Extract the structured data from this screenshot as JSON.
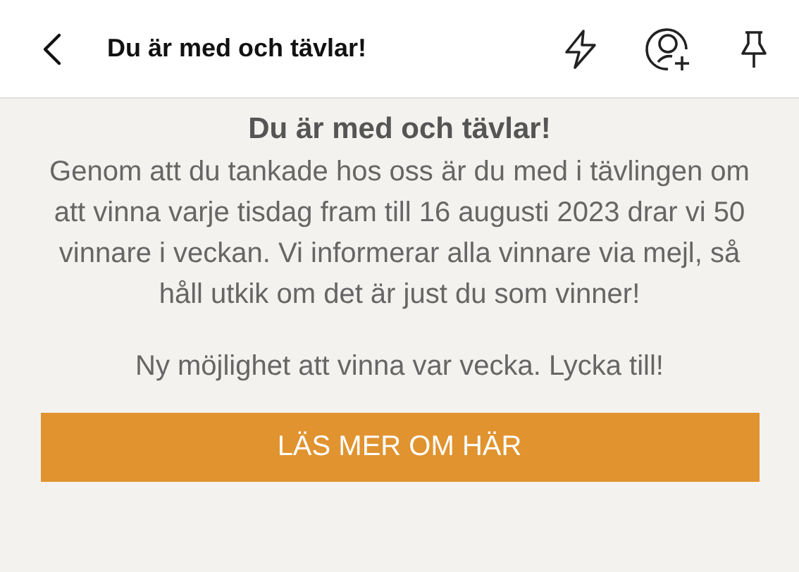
{
  "header": {
    "title": "Du är med och tävlar!"
  },
  "content": {
    "heading": "Du är med och tävlar!",
    "paragraphs": [
      "Genom att du tankade hos oss är du med i tävlingen om att vinna varje tisdag fram till 16 augusti 2023 drar vi 50 vinnare i veckan. Vi informerar alla vinnare via mejl, så håll utkik om det är just du som vinner!",
      "Ny möjlighet att vinna var vecka. Lycka till!"
    ],
    "button": "LÄS MER OM HÄR"
  }
}
